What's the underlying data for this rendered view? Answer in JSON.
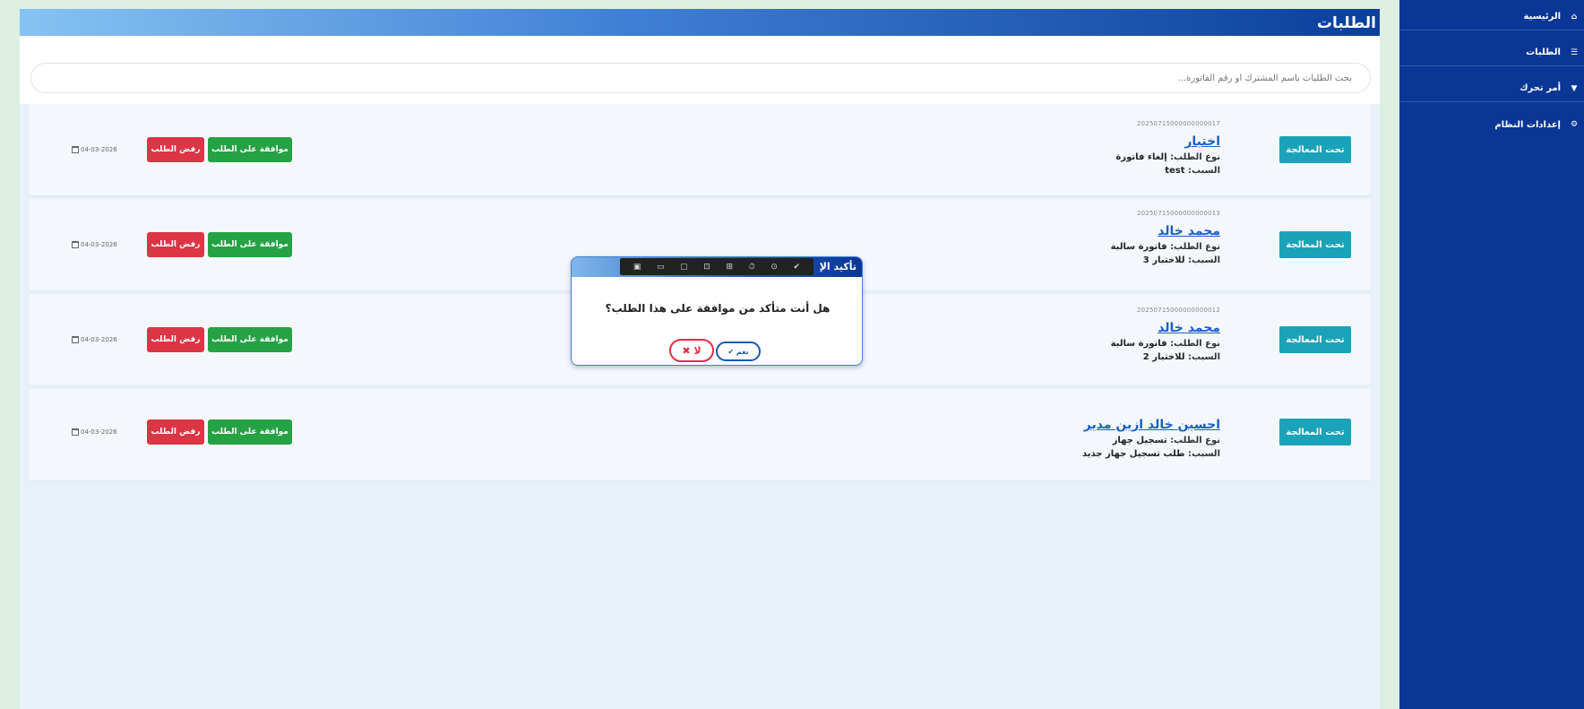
{
  "page": {
    "title": "الطلبات"
  },
  "search": {
    "placeholder": "بحث الطلبات باسم المشترك أو رقم الفاتورة..."
  },
  "sidebar": {
    "items": [
      {
        "label": "الرئيسية",
        "icon": "home-icon"
      },
      {
        "label": "الطلبات",
        "icon": "list-icon"
      },
      {
        "label": "أمر تحرك",
        "icon": "truck-icon"
      },
      {
        "label": "إعدادات النظام",
        "icon": "gear-icon"
      }
    ]
  },
  "requests": [
    {
      "status": "تحت المعالجة",
      "ref": "20250715000000000017",
      "name": "اختبار",
      "type_label": "نوع الطلب:",
      "type": "إلغاء فاتورة",
      "reason_label": "السبب:",
      "reason": "test",
      "approve": "موافقة على الطلب",
      "reject": "رفض الطلب",
      "date": "04-03-2026"
    },
    {
      "status": "تحت المعالجة",
      "ref": "20250715000000000013",
      "name": "محمد خالد",
      "type_label": "نوع الطلب:",
      "type": "فاتورة سالبة",
      "reason_label": "السبب:",
      "reason": "للاختبار 3",
      "approve": "موافقة على الطلب",
      "reject": "رفض الطلب",
      "date": "04-03-2026"
    },
    {
      "status": "تحت المعالجة",
      "ref": "20250715000000000012",
      "name": "محمد خالد",
      "type_label": "نوع الطلب:",
      "type": "فاتورة سالبة",
      "reason_label": "السبب:",
      "reason": "للاختبار 2",
      "approve": "موافقة على الطلب",
      "reject": "رفض الطلب",
      "date": "04-03-2026"
    },
    {
      "status": "تحت المعالجة",
      "ref": "",
      "name": "احسين خالد ازين مدير",
      "type_label": "نوع الطلب:",
      "type": "تسجيل جهاز",
      "reason_label": "السبب:",
      "reason": "طلب تسجيل جهاز جديد",
      "approve": "موافقة على الطلب",
      "reject": "رفض الطلب",
      "date": "04-03-2026"
    }
  ],
  "modal": {
    "title": "تأكيد الإ",
    "message": "هل أنت متأكد من موافقة على هذا الطلب؟",
    "yes": "✔ نعم",
    "no": "✖ لا"
  },
  "colors": {
    "sidebar": "#0a3796",
    "status": "#1aa3b8",
    "approve": "#25a244",
    "reject": "#dc3545",
    "link": "#1a5fc4"
  }
}
